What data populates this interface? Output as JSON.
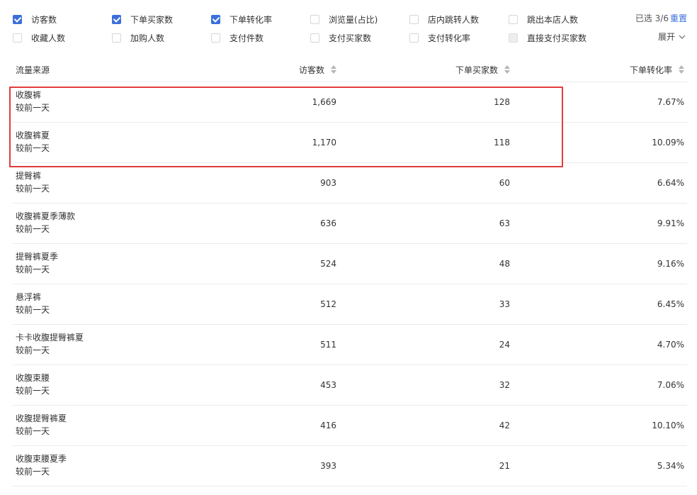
{
  "metrics": {
    "items": [
      {
        "label": "访客数",
        "checked": true,
        "disabled": false
      },
      {
        "label": "下单买家数",
        "checked": true,
        "disabled": false
      },
      {
        "label": "下单转化率",
        "checked": true,
        "disabled": false
      },
      {
        "label": "浏览量(占比)",
        "checked": false,
        "disabled": false
      },
      {
        "label": "店内跳转人数",
        "checked": false,
        "disabled": false
      },
      {
        "label": "跳出本店人数",
        "checked": false,
        "disabled": false
      },
      {
        "label": "收藏人数",
        "checked": false,
        "disabled": false
      },
      {
        "label": "加购人数",
        "checked": false,
        "disabled": false
      },
      {
        "label": "支付件数",
        "checked": false,
        "disabled": false
      },
      {
        "label": "支付买家数",
        "checked": false,
        "disabled": false
      },
      {
        "label": "支付转化率",
        "checked": false,
        "disabled": false
      },
      {
        "label": "直接支付买家数",
        "checked": false,
        "disabled": true
      }
    ],
    "selected_count": "已选 3/6",
    "reset_label": "重置",
    "expand_label": "展开"
  },
  "table": {
    "headers": {
      "source": "流量来源",
      "visitors": "访客数",
      "buyers": "下单买家数",
      "conversion": "下单转化率"
    },
    "rows": [
      {
        "name": "收腹裤",
        "sub": "较前一天",
        "visitors": "1,669",
        "buyers": "128",
        "conversion": "7.67%"
      },
      {
        "name": "收腹裤夏",
        "sub": "较前一天",
        "visitors": "1,170",
        "buyers": "118",
        "conversion": "10.09%"
      },
      {
        "name": "提臀裤",
        "sub": "较前一天",
        "visitors": "903",
        "buyers": "60",
        "conversion": "6.64%"
      },
      {
        "name": "收腹裤夏季薄款",
        "sub": "较前一天",
        "visitors": "636",
        "buyers": "63",
        "conversion": "9.91%"
      },
      {
        "name": "提臀裤夏季",
        "sub": "较前一天",
        "visitors": "524",
        "buyers": "48",
        "conversion": "9.16%"
      },
      {
        "name": "悬浮裤",
        "sub": "较前一天",
        "visitors": "512",
        "buyers": "33",
        "conversion": "6.45%"
      },
      {
        "name": "卡卡收腹提臀裤夏",
        "sub": "较前一天",
        "visitors": "511",
        "buyers": "24",
        "conversion": "4.70%"
      },
      {
        "name": "收腹束腰",
        "sub": "较前一天",
        "visitors": "453",
        "buyers": "32",
        "conversion": "7.06%"
      },
      {
        "name": "收腹提臀裤夏",
        "sub": "较前一天",
        "visitors": "416",
        "buyers": "42",
        "conversion": "10.10%"
      },
      {
        "name": "收腹束腰夏季",
        "sub": "较前一天",
        "visitors": "393",
        "buyers": "21",
        "conversion": "5.34%"
      }
    ]
  },
  "colors": {
    "accent": "#3b6fdc",
    "highlight_border": "#e23c3c",
    "row_divider": "#ebebeb"
  }
}
